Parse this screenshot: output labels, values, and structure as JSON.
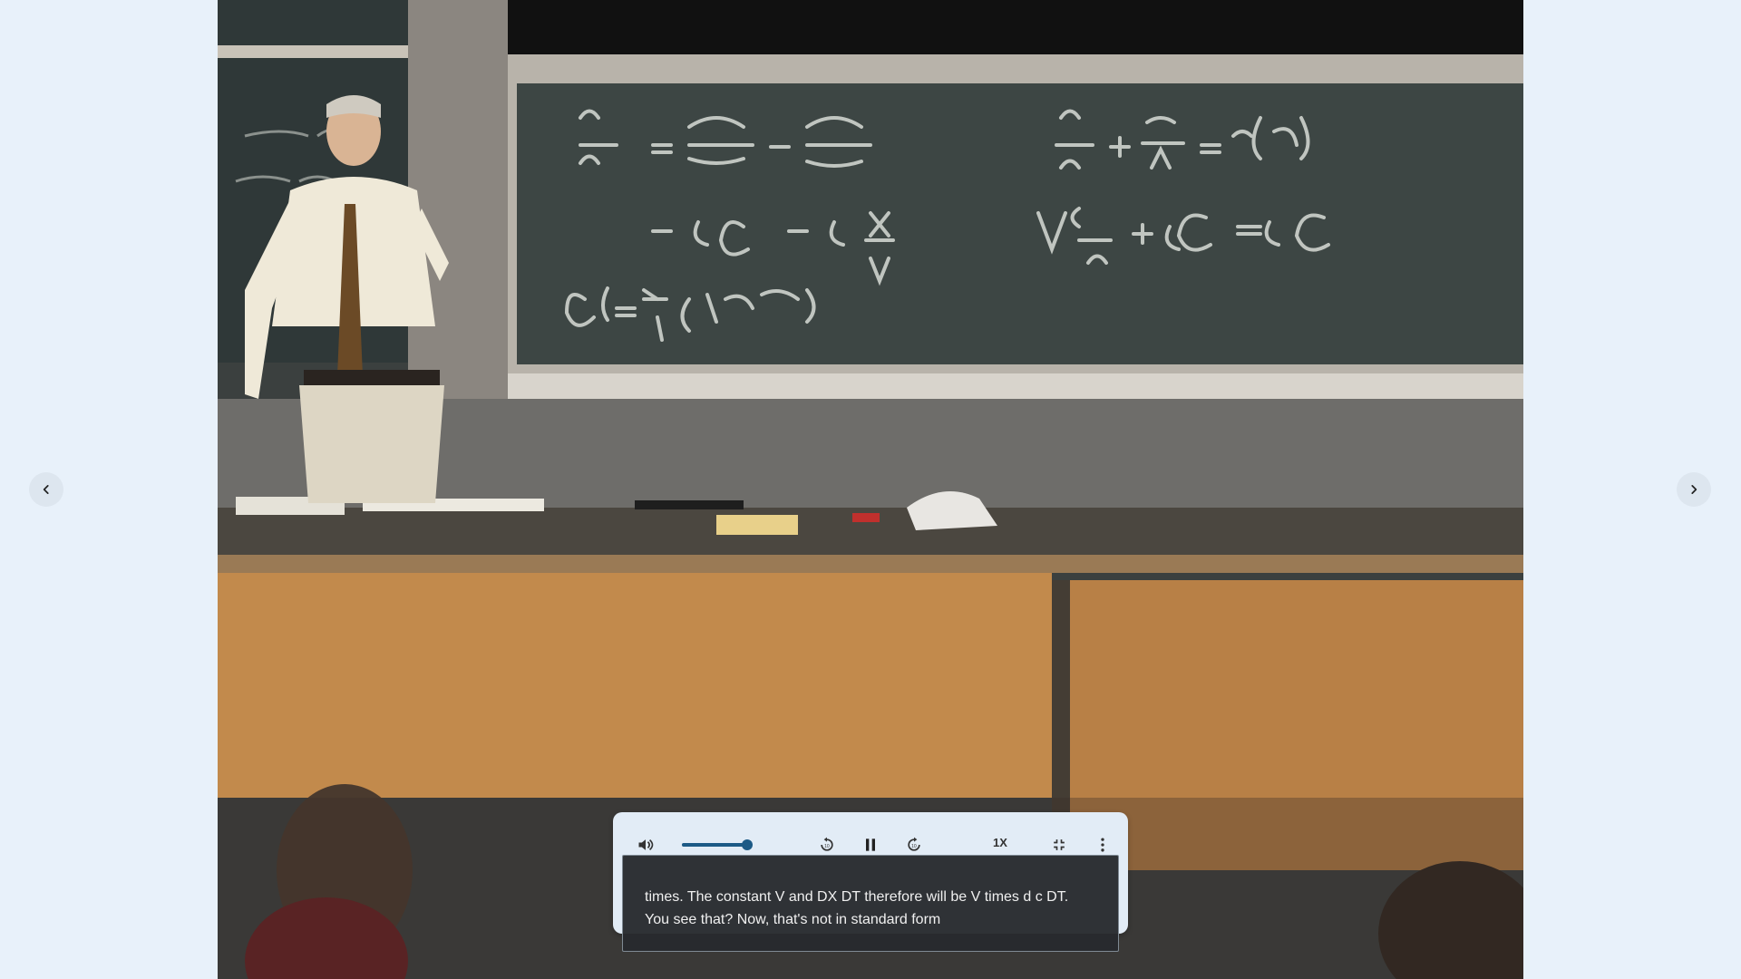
{
  "navigation": {
    "prev_icon": "chevron-left-icon",
    "next_icon": "chevron-right-icon"
  },
  "player": {
    "volume_icon": "volume-icon",
    "volume_level": 0.92,
    "replay_icon": "replay-10-icon",
    "pause_icon": "pause-icon",
    "forward_icon": "forward-10-icon",
    "speed_label": "1X",
    "exit_fullscreen_icon": "exit-fullscreen-icon",
    "more_icon": "more-vert-icon",
    "accent_color": "#1c5a86"
  },
  "captions": {
    "text": "times. The constant V and DX DT therefore will be V times d c DT. You see that? Now, that's not in standard form"
  }
}
